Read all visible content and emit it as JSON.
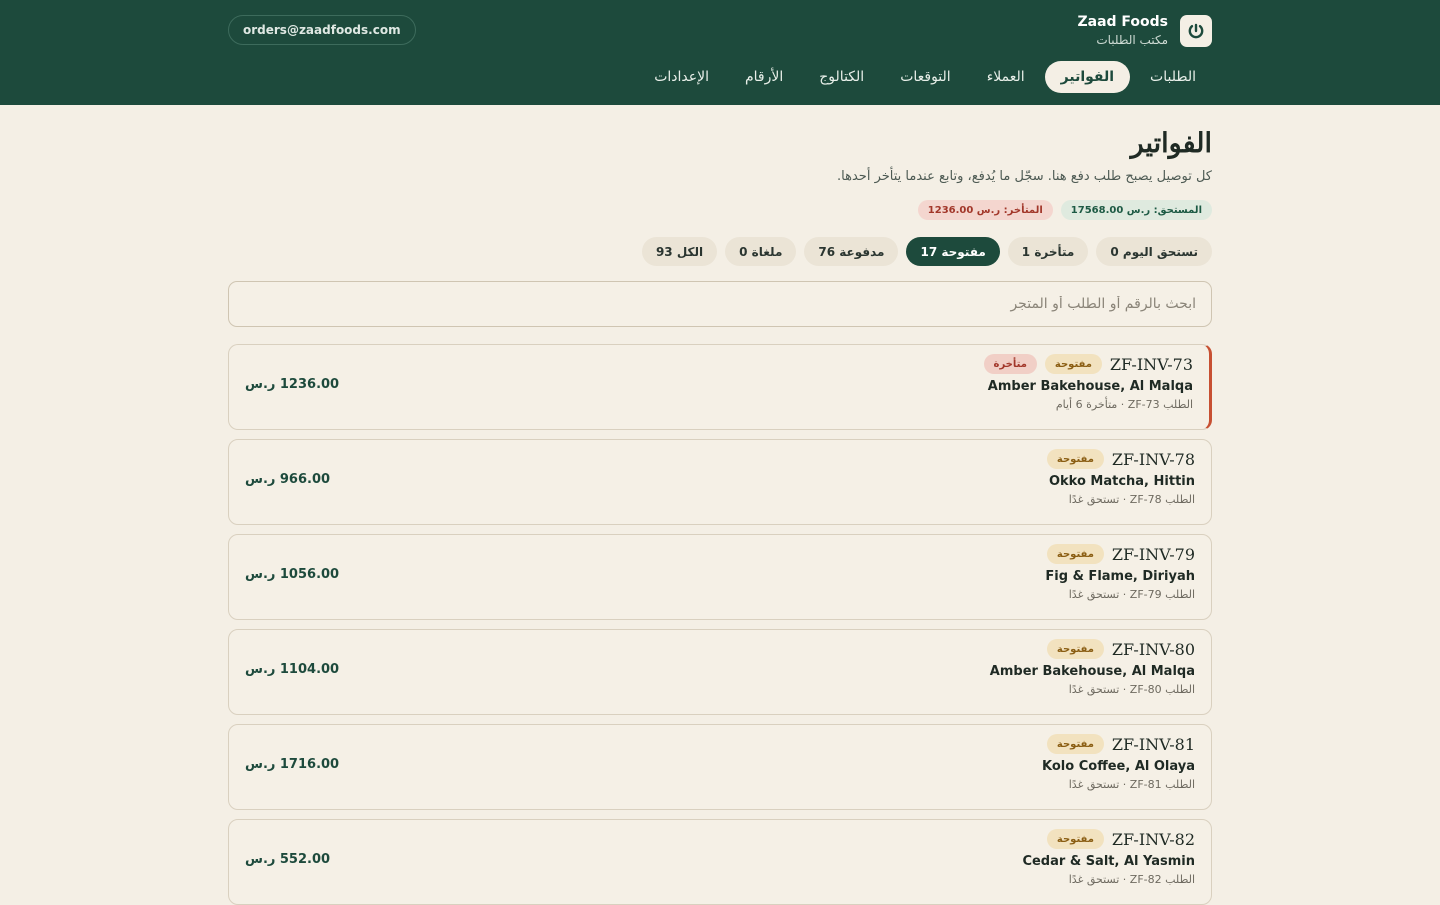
{
  "header": {
    "brand_name": "Zaad Foods",
    "brand_sub": "مكتب الطلبات",
    "email": "orders@zaadfoods.com",
    "nav": [
      {
        "label": "الطلبات",
        "active": false
      },
      {
        "label": "الفواتير",
        "active": true
      },
      {
        "label": "العملاء",
        "active": false
      },
      {
        "label": "التوقعات",
        "active": false
      },
      {
        "label": "الكتالوج",
        "active": false
      },
      {
        "label": "الأرقام",
        "active": false
      },
      {
        "label": "الإعدادات",
        "active": false
      }
    ]
  },
  "page": {
    "title": "الفواتير",
    "subtitle": "كل توصيل يصبح طلب دفع هنا. سجّل ما يُدفع، وتابع عندما يتأخر أحدها.",
    "summary": {
      "due": "المستحق: ر.س 17568.00",
      "late": "المتأخر: ر.س 1236.00"
    },
    "filters": [
      {
        "label": "تستحق اليوم 0",
        "active": false
      },
      {
        "label": "متأخرة 1",
        "active": false
      },
      {
        "label": "مفتوحة 17",
        "active": true
      },
      {
        "label": "مدفوعة 76",
        "active": false
      },
      {
        "label": "ملغاة 0",
        "active": false
      },
      {
        "label": "الكل 93",
        "active": false
      }
    ],
    "search_placeholder": "ابحث بالرقم أو الطلب أو المتجر"
  },
  "invoices": [
    {
      "number": "ZF-INV-73",
      "status": "مفتوحة",
      "late_badge": "متأخرة",
      "late": true,
      "store": "Amber Bakehouse, Al Malqa",
      "meta": "الطلب ZF-73 · متأخرة 6 أيام",
      "amount": "1236.00 ر.س"
    },
    {
      "number": "ZF-INV-78",
      "status": "مفتوحة",
      "late_badge": "",
      "late": false,
      "store": "Okko Matcha, Hittin",
      "meta": "الطلب ZF-78 · تستحق غدًا",
      "amount": "966.00 ر.س"
    },
    {
      "number": "ZF-INV-79",
      "status": "مفتوحة",
      "late_badge": "",
      "late": false,
      "store": "Fig & Flame, Diriyah",
      "meta": "الطلب ZF-79 · تستحق غدًا",
      "amount": "1056.00 ر.س"
    },
    {
      "number": "ZF-INV-80",
      "status": "مفتوحة",
      "late_badge": "",
      "late": false,
      "store": "Amber Bakehouse, Al Malqa",
      "meta": "الطلب ZF-80 · تستحق غدًا",
      "amount": "1104.00 ر.س"
    },
    {
      "number": "ZF-INV-81",
      "status": "مفتوحة",
      "late_badge": "",
      "late": false,
      "store": "Kolo Coffee, Al Olaya",
      "meta": "الطلب ZF-81 · تستحق غدًا",
      "amount": "1716.00 ر.س"
    },
    {
      "number": "ZF-INV-82",
      "status": "مفتوحة",
      "late_badge": "",
      "late": false,
      "store": "Cedar & Salt, Al Yasmin",
      "meta": "الطلب ZF-82 · تستحق غدًا",
      "amount": "552.00 ر.س"
    }
  ],
  "colors": {
    "header_bg": "#1d4a3c",
    "page_bg": "#f4efe5",
    "late_accent": "#c75032"
  }
}
